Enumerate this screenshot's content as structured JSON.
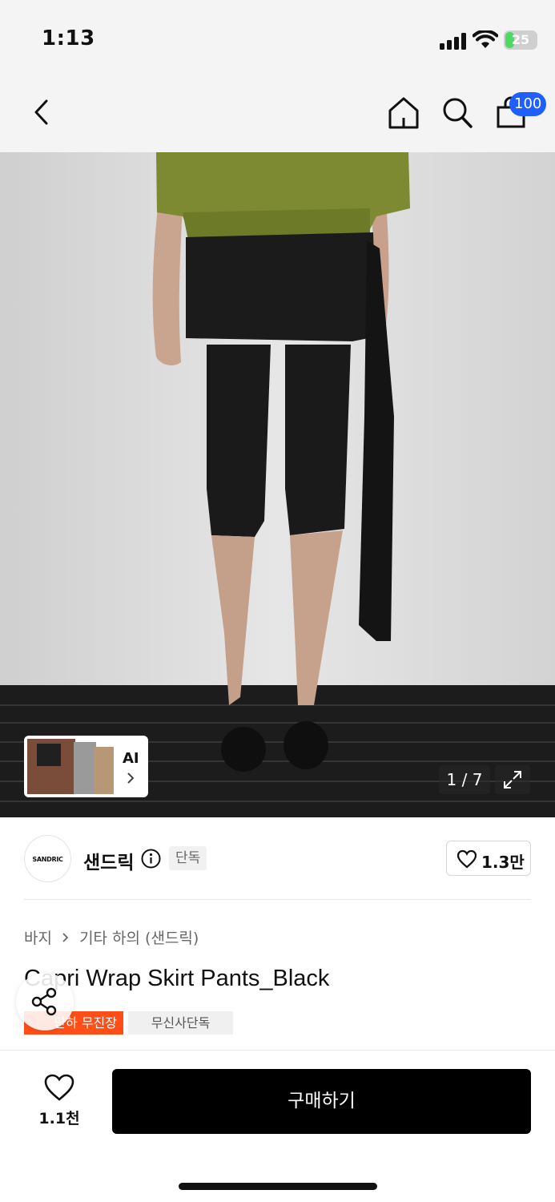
{
  "status_bar": {
    "time": "1:13",
    "battery": "25"
  },
  "nav": {
    "cart_count": "100",
    "icons": [
      "back-icon",
      "home-icon",
      "search-icon",
      "cart-icon"
    ]
  },
  "gallery": {
    "counter": "1 / 7",
    "ai_label": "AI"
  },
  "brand": {
    "logo_text": "SANDRIC",
    "name": "샌드릭",
    "exclusive": "단독",
    "likes": "1.3만"
  },
  "product": {
    "breadcrumb": [
      "바지",
      "기타 하의 (샌드릭)"
    ],
    "title": "Capri Wrap Skirt Pants_Black",
    "tags": [
      "단하 무진장",
      "무신사단독"
    ]
  },
  "bottom": {
    "wish_count": "1.1천",
    "buy_label": "구매하기"
  },
  "colors": {
    "accent": "#1f5eff",
    "tag_orange": "#ff4e17",
    "buy_bg": "#000000"
  }
}
